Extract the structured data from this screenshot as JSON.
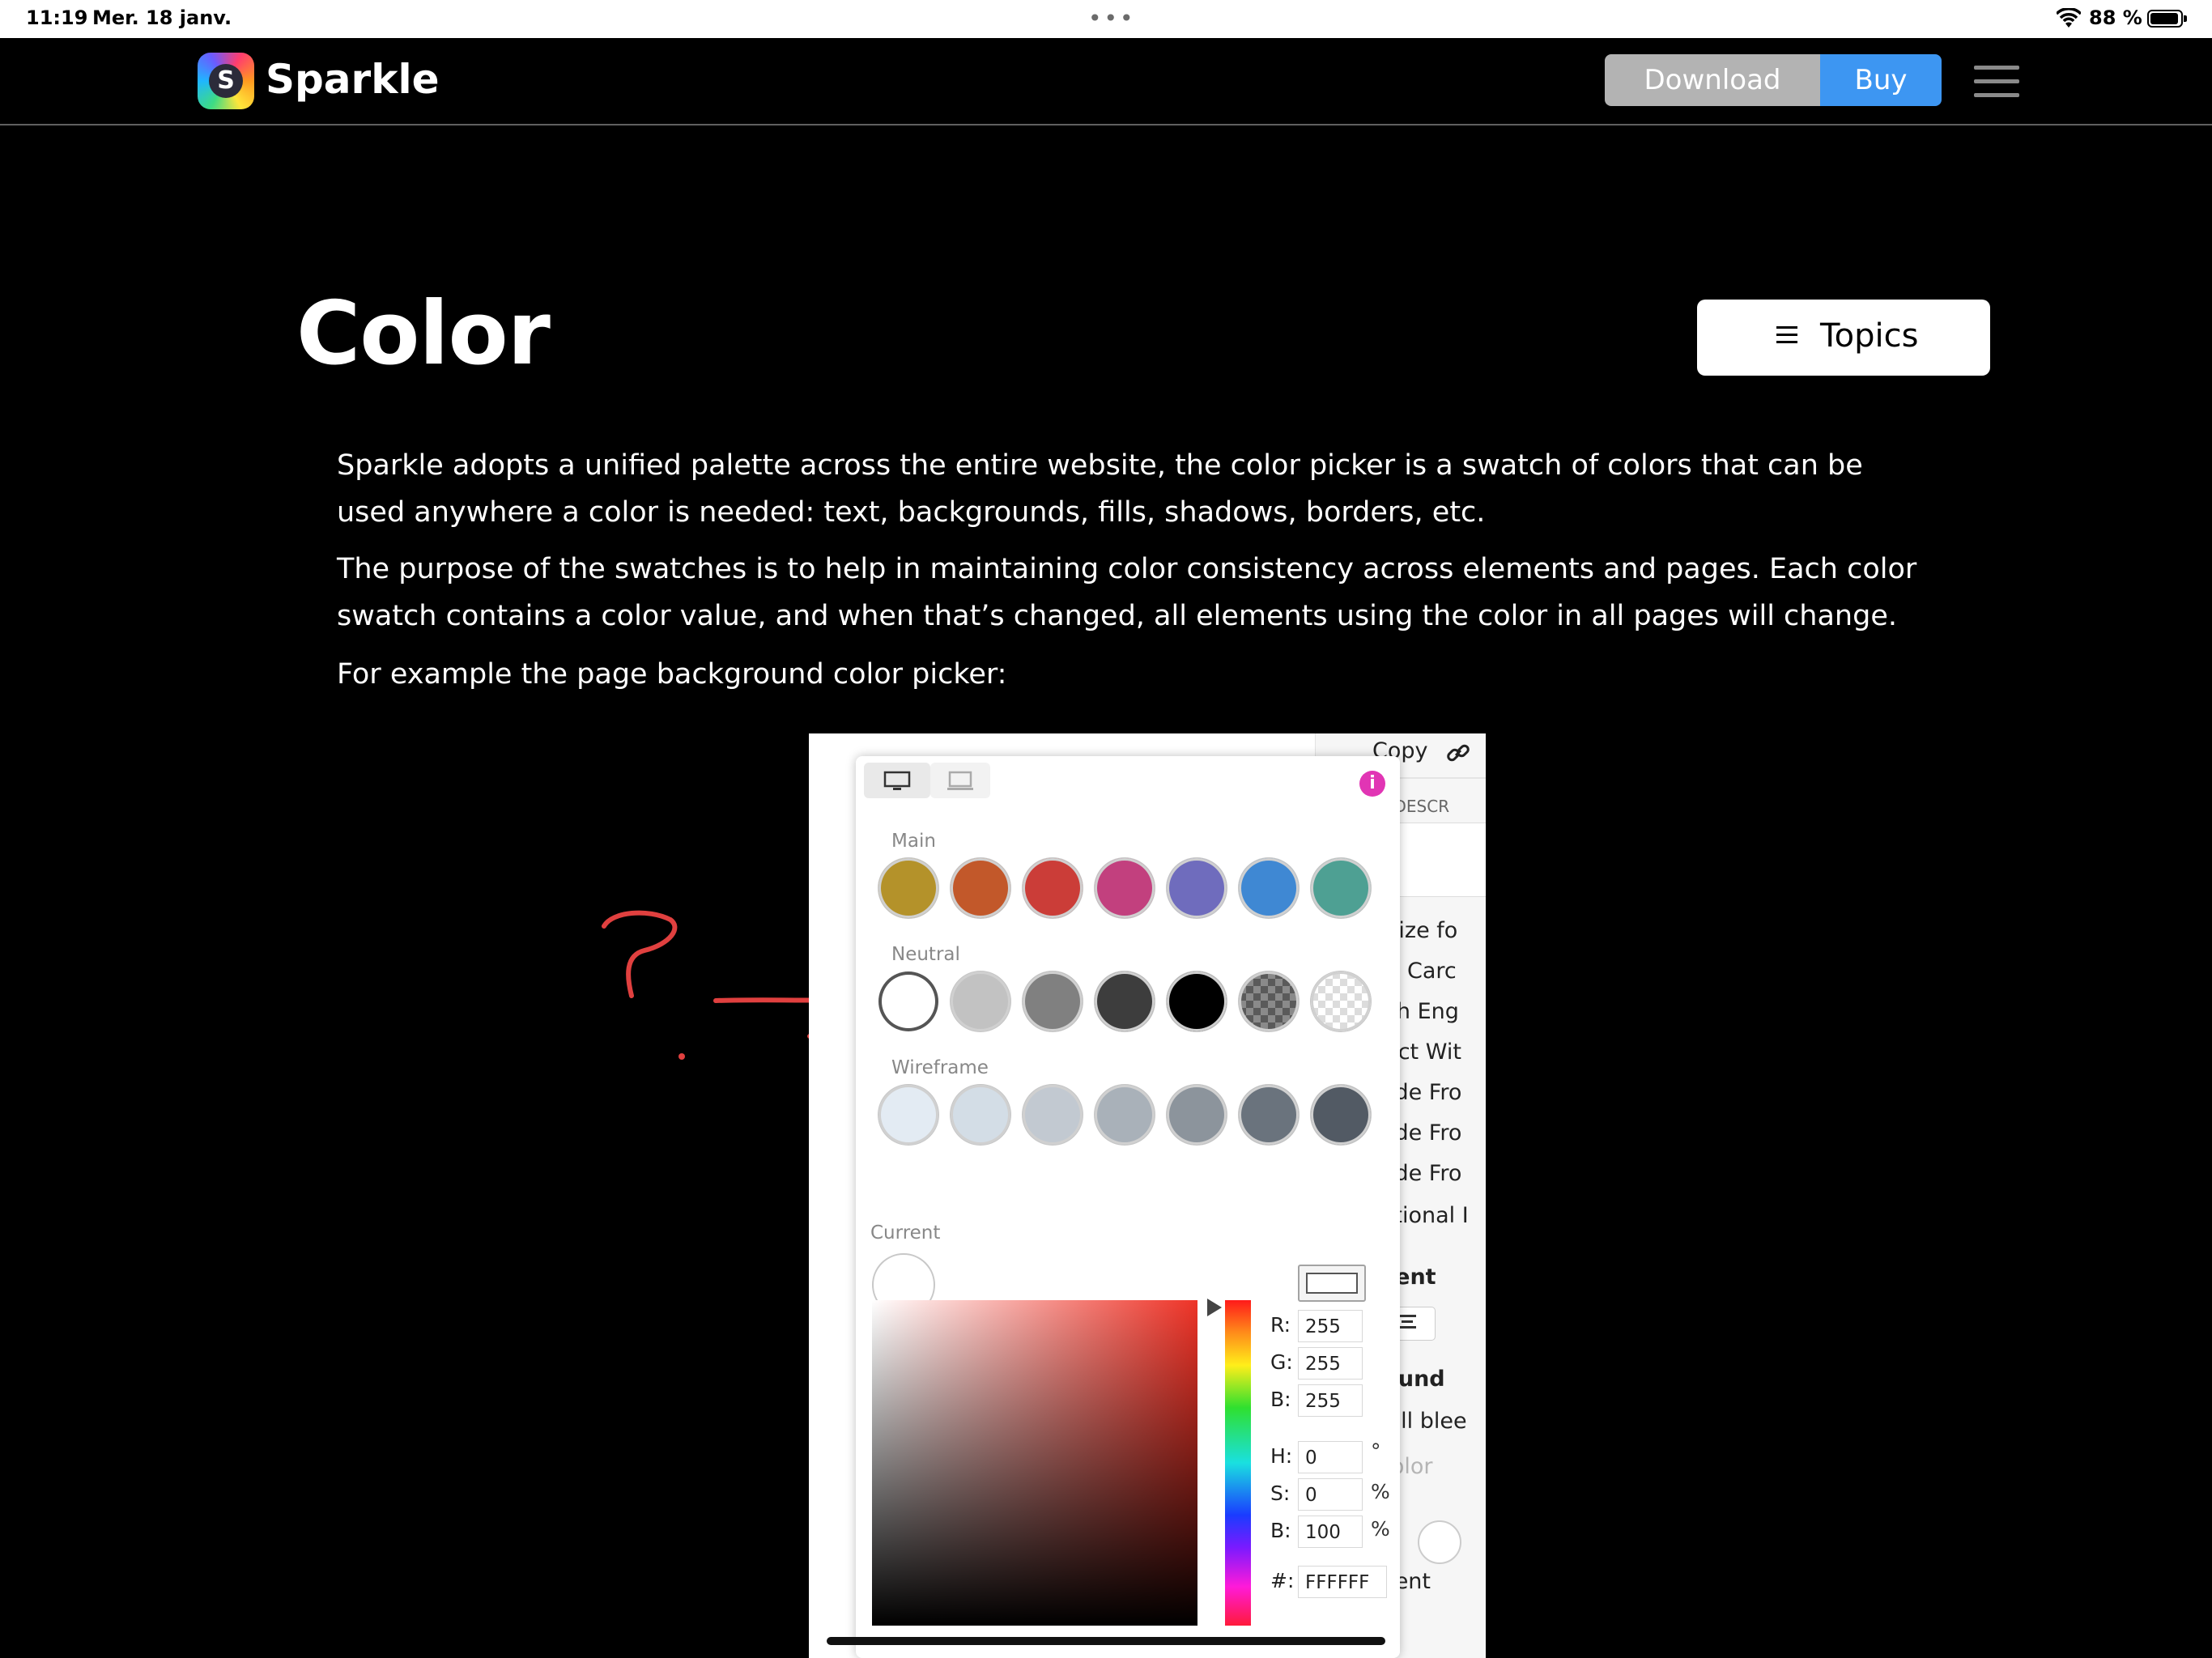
{
  "status_bar": {
    "time": "11:19",
    "date": "Mer. 18 janv.",
    "dots": "•••",
    "battery": "88 %"
  },
  "nav": {
    "logo_text": "Sparkle",
    "logo_glyph": "S",
    "download_label": "Download",
    "buy_label": "Buy",
    "accent_color": "#3d96f2"
  },
  "page": {
    "title": "Color",
    "topics_label": "Topics",
    "paragraphs": [
      "Sparkle adopts a unified palette across the entire website, the color picker is a swatch of colors that can be used anywhere a color is needed: text, backgrounds, fills, shadows, borders, etc.",
      "The purpose of the swatches is to help in maintaining color consistency across elements and pages. Each color swatch contains a color value, and when that’s changed, all elements using the color in all pages will change.",
      "For example the page background color picker:"
    ]
  },
  "screenshot": {
    "side": {
      "copy": "Copy",
      "ge_descr": "GE DESCR",
      "items": [
        "timize fo",
        "cial Carc",
        "arch Eng",
        "otect Wit",
        "clude Fro",
        "clude Fro",
        "clude Fro",
        "Optional I"
      ],
      "ment": "ment",
      "round": "round",
      "full_bleed": "Full blee",
      "color": "Color",
      "ntent": "ntent"
    },
    "picker": {
      "sections": {
        "main": "Main",
        "neutral": "Neutral",
        "wireframe": "Wireframe",
        "current": "Current"
      },
      "main_colors": [
        "#b4922a",
        "#c2582a",
        "#cb3d38",
        "#c2407e",
        "#6f6cbd",
        "#3f88d3",
        "#4ea093"
      ],
      "neutral_colors": [
        "#ffffff",
        "#c2c2c2",
        "#808080",
        "#3d3d3d",
        "#000000",
        "checker-dark",
        "checker-light"
      ],
      "wireframe_colors": [
        "#e3ebf3",
        "#d3dde6",
        "#c2c9d1",
        "#a9b1b9",
        "#8c949c",
        "#6a737d",
        "#525a64"
      ],
      "fields": {
        "r_label": "R:",
        "r": "255",
        "g_label": "G:",
        "g": "255",
        "b_label": "B:",
        "b": "255",
        "h_label": "H:",
        "h": "0",
        "h_unit": "°",
        "s_label": "S:",
        "s": "0",
        "s_unit": "%",
        "br_label": "B:",
        "br": "100",
        "br_unit": "%",
        "hex_label": "#:",
        "hex": "FFFFFF"
      },
      "info_icon_color": "#e135b4"
    },
    "annotation": {
      "question_mark": "?",
      "color": "#e0403f"
    }
  }
}
